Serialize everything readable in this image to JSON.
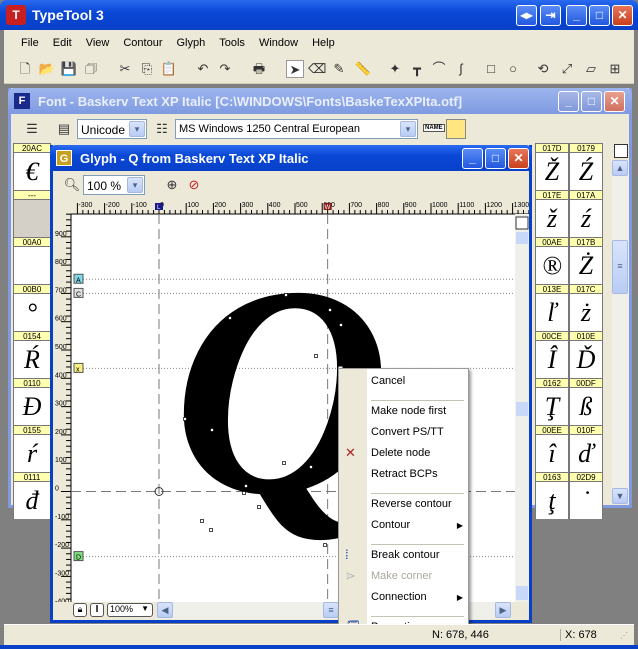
{
  "app": {
    "title": "TypeTool 3"
  },
  "menu": [
    "File",
    "Edit",
    "View",
    "Contour",
    "Glyph",
    "Tools",
    "Window",
    "Help"
  ],
  "font_window": {
    "title": "Font - Baskerv Text XP Italic [C:\\WINDOWS\\Fonts\\BaskeTexXPIta.otf]",
    "encoding_type": "Unicode",
    "codepage": "MS Windows 1250 Central European",
    "name_btn": "NAME",
    "left_cells": [
      {
        "code": "20AC",
        "glyph": "€"
      },
      {
        "code": "---",
        "glyph": ""
      },
      {
        "code": "00A0",
        "glyph": ""
      },
      {
        "code": "00B0",
        "glyph": "°"
      },
      {
        "code": "0154",
        "glyph": "Ŕ"
      },
      {
        "code": "0110",
        "glyph": "Đ"
      },
      {
        "code": "0155",
        "glyph": "ŕ"
      },
      {
        "code": "0111",
        "glyph": "đ"
      }
    ],
    "right_cells": [
      [
        {
          "code": "017D",
          "glyph": "Ž"
        },
        {
          "code": "0179",
          "glyph": "Ź"
        }
      ],
      [
        {
          "code": "017E",
          "glyph": "ž"
        },
        {
          "code": "017A",
          "glyph": "ź"
        }
      ],
      [
        {
          "code": "00AE",
          "glyph": "®"
        },
        {
          "code": "017B",
          "glyph": "Ż"
        }
      ],
      [
        {
          "code": "013E",
          "glyph": "ľ"
        },
        {
          "code": "017C",
          "glyph": "ż"
        }
      ],
      [
        {
          "code": "00CE",
          "glyph": "Î"
        },
        {
          "code": "010E",
          "glyph": "Ď"
        }
      ],
      [
        {
          "code": "0162",
          "glyph": "Ţ"
        },
        {
          "code": "00DF",
          "glyph": "ß"
        }
      ],
      [
        {
          "code": "00EE",
          "glyph": "î"
        },
        {
          "code": "010F",
          "glyph": "ď"
        }
      ],
      [
        {
          "code": "0163",
          "glyph": "ţ"
        },
        {
          "code": "02D9",
          "glyph": "˙"
        }
      ]
    ]
  },
  "glyph_window": {
    "title": "Glyph - Q from Baskerv Text XP Italic",
    "zoom": "100 %",
    "bottom_zoom": "100%",
    "glyph": "Q",
    "h_ruler": [
      "-300",
      "-200",
      "-100",
      "0",
      "100",
      "200",
      "300",
      "400",
      "500",
      "600",
      "700",
      "800",
      "900",
      "1000",
      "1100",
      "1200",
      "1300"
    ],
    "v_ruler": [
      "900",
      "800",
      "700",
      "600",
      "500",
      "400",
      "300",
      "200",
      "100",
      "0",
      "-100",
      "-200",
      "-300",
      "-400"
    ],
    "guides": [
      {
        "label": "A",
        "value": 750,
        "color": "#7fd8e8"
      },
      {
        "label": "C",
        "value": 700,
        "color": "#e0e0e0"
      },
      {
        "label": "x",
        "value": 435,
        "color": "#f8f080"
      },
      {
        "label": "D",
        "value": -230,
        "color": "#80e080"
      }
    ],
    "markers": {
      "left": "L",
      "width": "W"
    },
    "node_readout": "678, 446"
  },
  "context_menu": [
    {
      "label": "Cancel"
    },
    {
      "sep": true
    },
    {
      "label": "Make node first"
    },
    {
      "label": "Convert PS/TT"
    },
    {
      "label": "Delete node",
      "icon": "delete"
    },
    {
      "label": "Retract BCPs"
    },
    {
      "sep": true
    },
    {
      "label": "Reverse contour"
    },
    {
      "label": "Contour",
      "sub": true
    },
    {
      "sep": true
    },
    {
      "label": "Break contour",
      "icon": "break"
    },
    {
      "label": "Make corner",
      "disabled": true,
      "icon": "corner"
    },
    {
      "label": "Connection",
      "sub": true
    },
    {
      "sep": true
    },
    {
      "label": "Properties",
      "icon": "props"
    }
  ],
  "status": {
    "node": "N: 678, 446",
    "x": "X: 678"
  }
}
